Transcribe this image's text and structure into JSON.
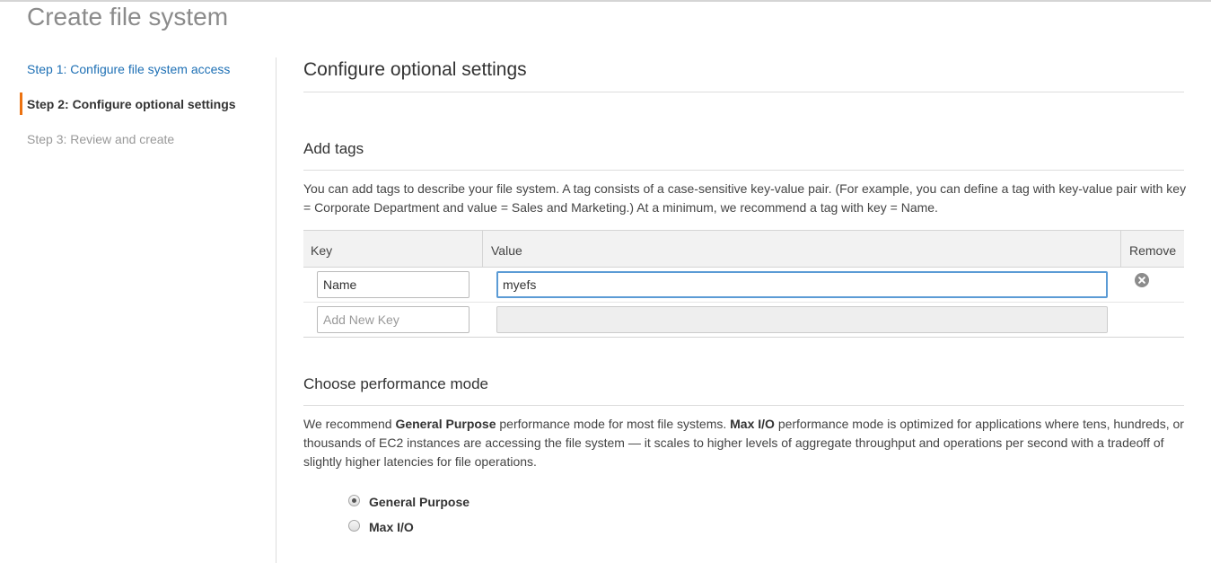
{
  "page": {
    "title": "Create file system"
  },
  "steps": [
    {
      "label": "Step 1: Configure file system access",
      "state": "link"
    },
    {
      "label": "Step 2: Configure optional settings",
      "state": "current"
    },
    {
      "label": "Step 3: Review and create",
      "state": "disabled"
    }
  ],
  "main": {
    "heading": "Configure optional settings"
  },
  "tags": {
    "heading": "Add tags",
    "description": "You can add tags to describe your file system. A tag consists of a case-sensitive key-value pair. (For example, you can define a tag with key-value pair with key = Corporate Department and value = Sales and Marketing.) At a minimum, we recommend a tag with key = Name.",
    "columns": {
      "key": "Key",
      "value": "Value",
      "remove": "Remove"
    },
    "rows": [
      {
        "key": "Name",
        "value": "myefs"
      }
    ],
    "new_row": {
      "key_placeholder": "Add New Key",
      "value": ""
    }
  },
  "performance": {
    "heading": "Choose performance mode",
    "desc_1": "We recommend ",
    "desc_bold_1": "General Purpose",
    "desc_2": " performance mode for most file systems. ",
    "desc_bold_2": "Max I/O",
    "desc_3": " performance mode is optimized for applications where tens, hundreds, or thousands of EC2 instances are accessing the file system — it scales to higher levels of aggregate throughput and operations per second with a tradeoff of slightly higher latencies for file operations.",
    "options": [
      {
        "label": "General Purpose",
        "selected": true
      },
      {
        "label": "Max I/O",
        "selected": false
      }
    ]
  },
  "colors": {
    "step_accent": "#ec7211",
    "link": "#1e70b5",
    "focus_border": "#5b9bd5"
  }
}
